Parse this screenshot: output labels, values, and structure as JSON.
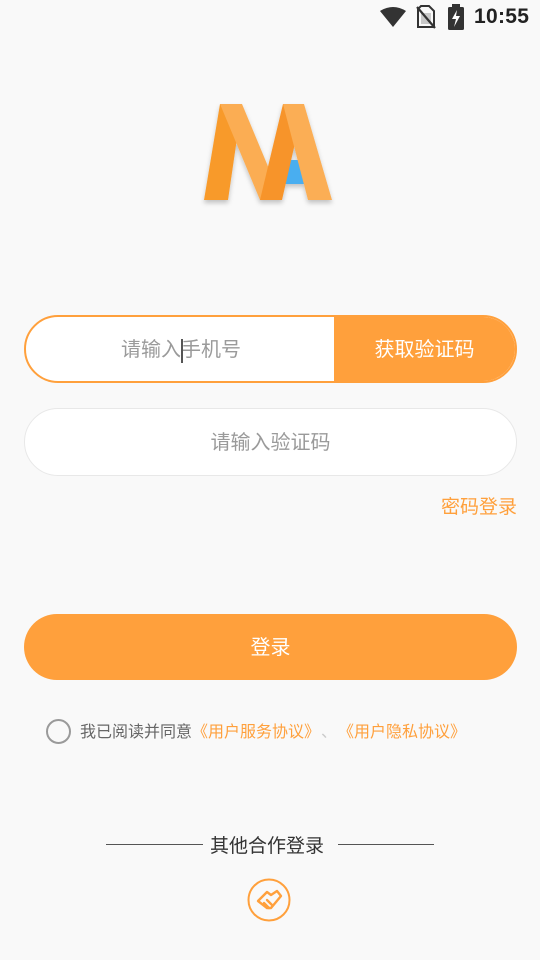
{
  "status_bar": {
    "time": "10:55",
    "icons": [
      "wifi-icon",
      "no-sim-icon",
      "battery-charging-icon"
    ]
  },
  "logo": {
    "icon": "app-logo-ma",
    "colors": {
      "orange": "#f99b2e",
      "orange_light": "#fbae55",
      "blue": "#4aaef0"
    }
  },
  "phone": {
    "placeholder": "请输入手机号",
    "value": "",
    "get_code_label": "获取验证码"
  },
  "code": {
    "placeholder": "请输入验证码",
    "value": ""
  },
  "password_login_label": "密码登录",
  "login_label": "登录",
  "agreement": {
    "checked": false,
    "prefix": "我已阅读并同意",
    "user_service_link": "《用户服务协议》",
    "separator": "、",
    "privacy_link": "《用户隐私协议》"
  },
  "other_login": {
    "title": "其他合作登录",
    "partner_icon": "handshake-icon"
  },
  "colors": {
    "accent": "#ffa03c",
    "background": "#f9f9f9",
    "placeholder": "#9a9a9a"
  }
}
